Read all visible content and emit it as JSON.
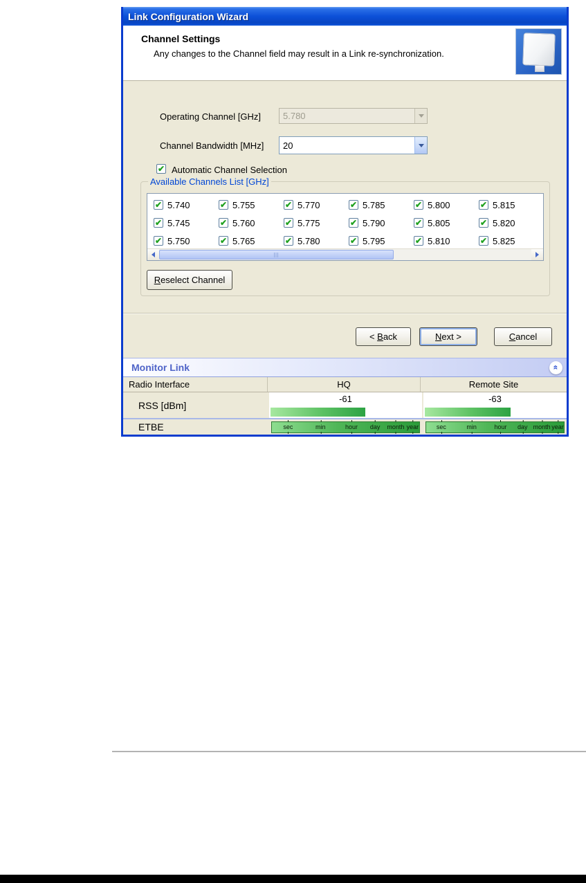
{
  "window": {
    "title": "Link Configuration Wizard"
  },
  "header": {
    "title": "Channel Settings",
    "subtitle": "Any changes to the Channel field may result in a Link re-synchronization."
  },
  "form": {
    "operating_channel_label": "Operating Channel [GHz]",
    "operating_channel_value": "5.780",
    "bandwidth_label": "Channel Bandwidth [MHz]",
    "bandwidth_value": "20",
    "auto_select_label": "Automatic Channel Selection"
  },
  "channels": {
    "group_title": "Available Channels List [GHz]",
    "all_checked": true,
    "items": [
      "5.740",
      "5.755",
      "5.770",
      "5.785",
      "5.800",
      "5.815",
      "5.745",
      "5.760",
      "5.775",
      "5.790",
      "5.805",
      "5.820",
      "5.750",
      "5.765",
      "5.780",
      "5.795",
      "5.810",
      "5.825"
    ],
    "reselect": {
      "pre": "",
      "key": "R",
      "post": "eselect Channel"
    }
  },
  "buttons": {
    "back": {
      "pre": "< ",
      "key": "B",
      "post": "ack"
    },
    "next": {
      "pre": "",
      "key": "N",
      "post": "ext >"
    },
    "cancel": {
      "pre": "",
      "key": "C",
      "post": "ancel"
    }
  },
  "monitor": {
    "title": "Monitor Link",
    "columns": {
      "c1": "Radio Interface",
      "c2": "HQ",
      "c3": "Remote Site"
    },
    "rss": {
      "label": "RSS [dBm]",
      "hq_value": "-61",
      "hq_bar_pct": 62,
      "remote_value": "-63",
      "remote_bar_pct": 60
    },
    "etbe": {
      "label": "ETBE",
      "ticks": [
        "sec",
        "min",
        "hour",
        "day",
        "month",
        "year"
      ]
    }
  },
  "colors": {
    "titlebar_blue": "#0c50d8",
    "dialog_border_blue": "#0a3cce",
    "dialog_bg": "#ece9d8",
    "group_title_blue": "#0046d5",
    "bar_green": "#2da344",
    "monitor_title_blue": "#4f64c8"
  }
}
